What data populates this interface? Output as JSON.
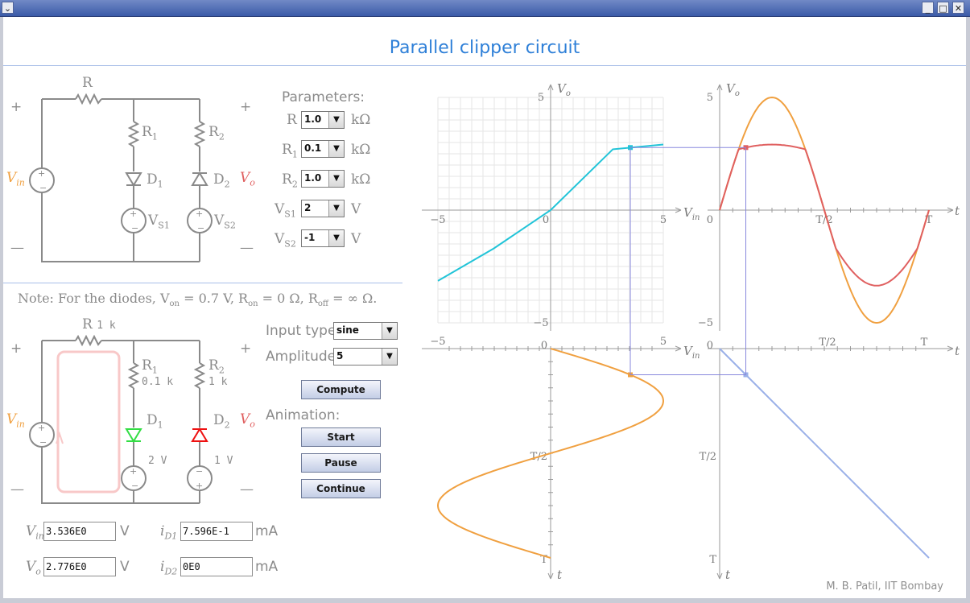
{
  "window": {
    "title": ""
  },
  "page_title": "Parallel clipper circuit",
  "credit": "M. B. Patil, IIT Bombay",
  "circuit_top": {
    "R": "R",
    "R1": "R",
    "R1_sub": "1",
    "R2": "R",
    "R2_sub": "2",
    "D1": "D",
    "D1_sub": "1",
    "D2": "D",
    "D2_sub": "2",
    "VS1": "V",
    "VS1_sub": "S1",
    "VS2": "V",
    "VS2_sub": "S2",
    "Vin": "V",
    "Vin_sub": "in",
    "Vo": "V",
    "Vo_sub": "o",
    "plus": "+",
    "minus": "—"
  },
  "parameters": {
    "heading": "Parameters:",
    "R_label": "R",
    "R_value": "1.0",
    "R_unit": "kΩ",
    "R1_label": "R",
    "R1_sub": "1",
    "R1_value": "0.1",
    "R1_unit": "kΩ",
    "R2_label": "R",
    "R2_sub": "2",
    "R2_value": "1.0",
    "R2_unit": "kΩ",
    "VS1_label": "V",
    "VS1_sub": "S1",
    "VS1_value": "2",
    "VS1_unit": "V",
    "VS2_label": "V",
    "VS2_sub": "S2",
    "VS2_value": "-1",
    "VS2_unit": "V"
  },
  "note": "Note:  For the diodes, V",
  "note_on": "on",
  "note_mid1": " = 0.7 V,  R",
  "note_ron": "on",
  "note_mid2": " = 0 Ω,  R",
  "note_roff": "off",
  "note_end": " = ∞ Ω.",
  "circuit_bottom": {
    "R": "R",
    "R_val": "1 k",
    "R1": "R",
    "R1_sub": "1",
    "R1_val": "0.1 k",
    "R2": "R",
    "R2_sub": "2",
    "R2_val": "1 k",
    "D1": "D",
    "D1_sub": "1",
    "D2": "D",
    "D2_sub": "2",
    "VS1_val": "2 V",
    "VS2_val": "1 V",
    "Vin": "V",
    "Vin_sub": "in",
    "Vo": "V",
    "Vo_sub": "o",
    "plus": "+",
    "minus": "—",
    "colors": {
      "d1": "#33dd44",
      "d2": "#ee1111",
      "loop": "#f8c8c8"
    }
  },
  "controls": {
    "input_type_label": "Input type",
    "input_type_value": "sine",
    "amplitude_label": "Amplitude",
    "amplitude_value": "5",
    "compute": "Compute",
    "animation_label": "Animation:",
    "start": "Start",
    "pause": "Pause",
    "continue": "Continue"
  },
  "readouts": {
    "vin_label": "V",
    "vin_sub": "in",
    "vin_value": "3.536E0",
    "vin_unit": "V",
    "vo_label": "V",
    "vo_sub": "o",
    "vo_value": "2.776E0",
    "vo_unit": "V",
    "id1_label": "i",
    "id1_sub": "D1",
    "id1_value": "7.596E-1",
    "id1_unit": "mA",
    "id2_label": "i",
    "id2_sub": "D2",
    "id2_value": "0E0",
    "id2_unit": "mA"
  },
  "chart_data": [
    {
      "type": "line",
      "title": "",
      "xlabel": "V",
      "xlabel_sub": "in",
      "ylabel": "V",
      "ylabel_sub": "o",
      "xlim": [
        -5,
        5
      ],
      "ylim": [
        -5,
        5
      ],
      "grid": true,
      "x_ticks": [
        "−5",
        "0",
        "5"
      ],
      "y_ticks": [
        "5",
        "−5"
      ],
      "series": [
        {
          "x": [
            -5,
            -2.52,
            0,
            2.76,
            5
          ],
          "y": [
            -3.14,
            -1.7,
            0,
            2.7,
            2.91
          ],
          "color": "#22c4d8"
        }
      ],
      "marker": {
        "x": 3.536,
        "y": 2.776
      }
    },
    {
      "type": "line",
      "title": "",
      "xlabel": "t",
      "ylabel": "V",
      "ylabel_sub": "o",
      "ylim": [
        -5,
        5
      ],
      "x_ticks": [
        "0",
        "T/2",
        "T"
      ],
      "y_ticks": [
        "5",
        "−5"
      ],
      "series": [
        {
          "name": "",
          "function": "5 sin(2πt/T)",
          "color": "#f0a040"
        },
        {
          "name": "",
          "function": "clipped output",
          "color": "#e06060"
        }
      ],
      "marker_t_over_T": 0.125
    },
    {
      "type": "line",
      "title": "",
      "xlabel": "V",
      "xlabel_sub": "in",
      "ylabel": "t",
      "xlim": [
        -5,
        5
      ],
      "x_ticks": [
        "−5",
        "0",
        "5"
      ],
      "y_ticks": [
        "T/2",
        "T"
      ],
      "series": [
        {
          "function": "V_in(t) = 5 sin(2πt/T)",
          "color": "#f0a040"
        }
      ]
    },
    {
      "type": "line",
      "title": "",
      "xlabel": "t",
      "ylabel": "t",
      "x_ticks": [
        "0",
        "T/2",
        "T"
      ],
      "y_ticks": [
        "T/2",
        "T"
      ],
      "series": [
        {
          "function": "t = t",
          "color": "#9ab0e8"
        }
      ]
    }
  ]
}
